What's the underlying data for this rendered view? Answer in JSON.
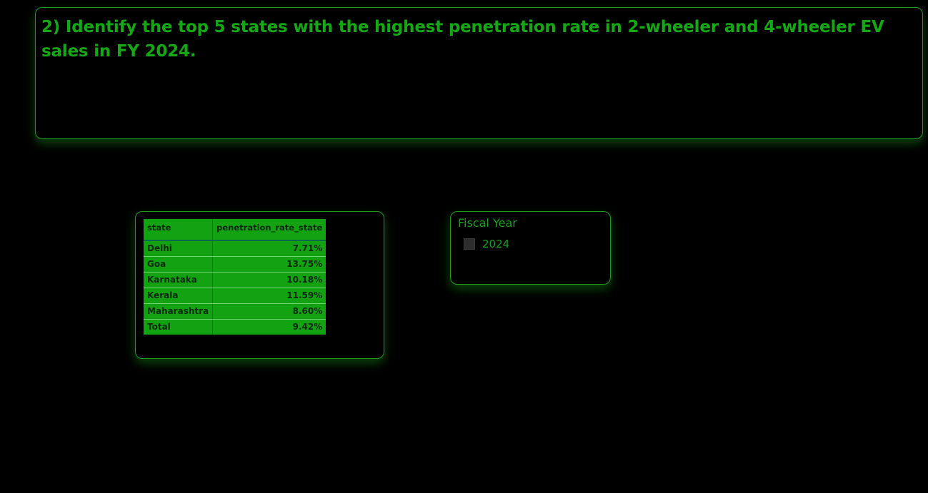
{
  "title": {
    "text": "2) Identify the top 5 states with the highest penetration rate in 2-wheeler and 4-wheeler EV sales in FY 2024."
  },
  "table": {
    "headers": [
      "state",
      "penetration_rate_state"
    ],
    "rows": [
      {
        "state": "Delhi",
        "rate": "7.71%"
      },
      {
        "state": "Goa",
        "rate": "13.75%"
      },
      {
        "state": "Karnataka",
        "rate": "10.18%"
      },
      {
        "state": "Kerala",
        "rate": "11.59%"
      },
      {
        "state": "Maharashtra",
        "rate": "8.60%"
      }
    ],
    "total": {
      "label": "Total",
      "rate": "9.42%"
    }
  },
  "slicer": {
    "title": "Fiscal Year",
    "options": [
      {
        "label": "2024",
        "checked": false
      }
    ]
  },
  "colors": {
    "background": "#000000",
    "accent": "#14a814",
    "table_fill": "#12a212",
    "checkbox": "#2d2d2d"
  }
}
